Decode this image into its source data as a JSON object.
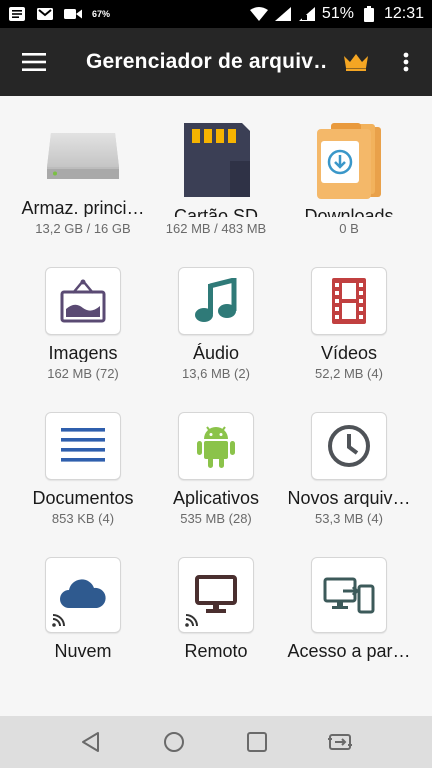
{
  "status_bar": {
    "small_text": "67%",
    "battery": "51%",
    "time": "12:31"
  },
  "app_bar": {
    "title": "Gerenciador de arquiv…",
    "accent": "#f5a623"
  },
  "tiles": [
    {
      "label": "Armaz. princi…",
      "sub": "13,2 GB / 16 GB",
      "icon": "hard-drive-icon"
    },
    {
      "label": "Cartão SD",
      "sub": "162 MB / 483 MB",
      "icon": "sd-card-icon"
    },
    {
      "label": "Downloads",
      "sub": "0 B",
      "icon": "downloads-folder-icon"
    },
    {
      "label": "Imagens",
      "sub": "162 MB (72)",
      "icon": "picture-frame-icon"
    },
    {
      "label": "Áudio",
      "sub": "13,6 MB (2)",
      "icon": "music-note-icon"
    },
    {
      "label": "Vídeos",
      "sub": "52,2 MB (4)",
      "icon": "film-strip-icon"
    },
    {
      "label": "Documentos",
      "sub": "853 KB (4)",
      "icon": "document-lines-icon"
    },
    {
      "label": "Aplicativos",
      "sub": "535 MB (28)",
      "icon": "android-icon"
    },
    {
      "label": "Novos arquiv…",
      "sub": "53,3 MB (4)",
      "icon": "clock-icon"
    },
    {
      "label": "Nuvem",
      "sub": "",
      "icon": "cloud-icon"
    },
    {
      "label": "Remoto",
      "sub": "",
      "icon": "monitor-icon"
    },
    {
      "label": "Acesso a par…",
      "sub": "",
      "icon": "pc-to-device-icon"
    }
  ],
  "nav_bar": {
    "buttons": [
      "back-icon",
      "home-icon",
      "recents-icon",
      "screen-cast-icon"
    ]
  }
}
